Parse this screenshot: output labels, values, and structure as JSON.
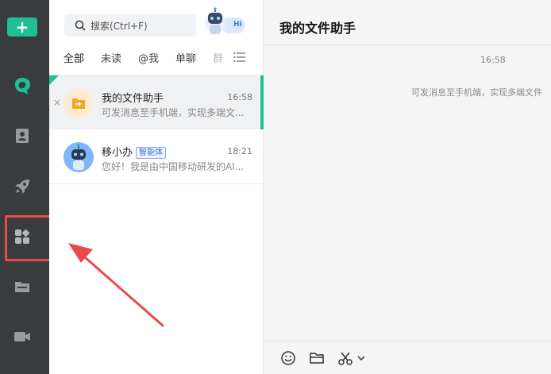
{
  "sidebar": {
    "add_label": "+",
    "icons": [
      "brand-logo-icon",
      "contacts-icon",
      "rocket-icon",
      "apps-icon",
      "folder-icon",
      "video-icon"
    ],
    "accent_color": "#1dbf93",
    "highlight_color": "#e84b4b"
  },
  "chat_list": {
    "search_placeholder": "搜索(Ctrl+F)",
    "tabs": [
      {
        "label": "全部"
      },
      {
        "label": "未读"
      },
      {
        "label": "@我"
      },
      {
        "label": "单聊"
      },
      {
        "label": "群"
      }
    ],
    "conversations": [
      {
        "title": "我的文件助手",
        "time": "16:58",
        "preview": "可发消息至手机端，实现多端文...",
        "close_glyph": "×",
        "icon": "file-transfer-icon"
      },
      {
        "title": "移小办",
        "badge": "智能体",
        "time": "18:21",
        "preview": "您好！我是由中国移动研发的AI...",
        "icon": "robot-avatar"
      }
    ]
  },
  "chat": {
    "title": "我的文件助手",
    "time": "16:58",
    "system_message": "可发消息至手机端，实现多端文件",
    "toolbar": [
      "emoji-icon",
      "folder-icon",
      "scissors-icon",
      "chevron-down-icon"
    ]
  },
  "ai_helper": {
    "label": "Hi"
  }
}
